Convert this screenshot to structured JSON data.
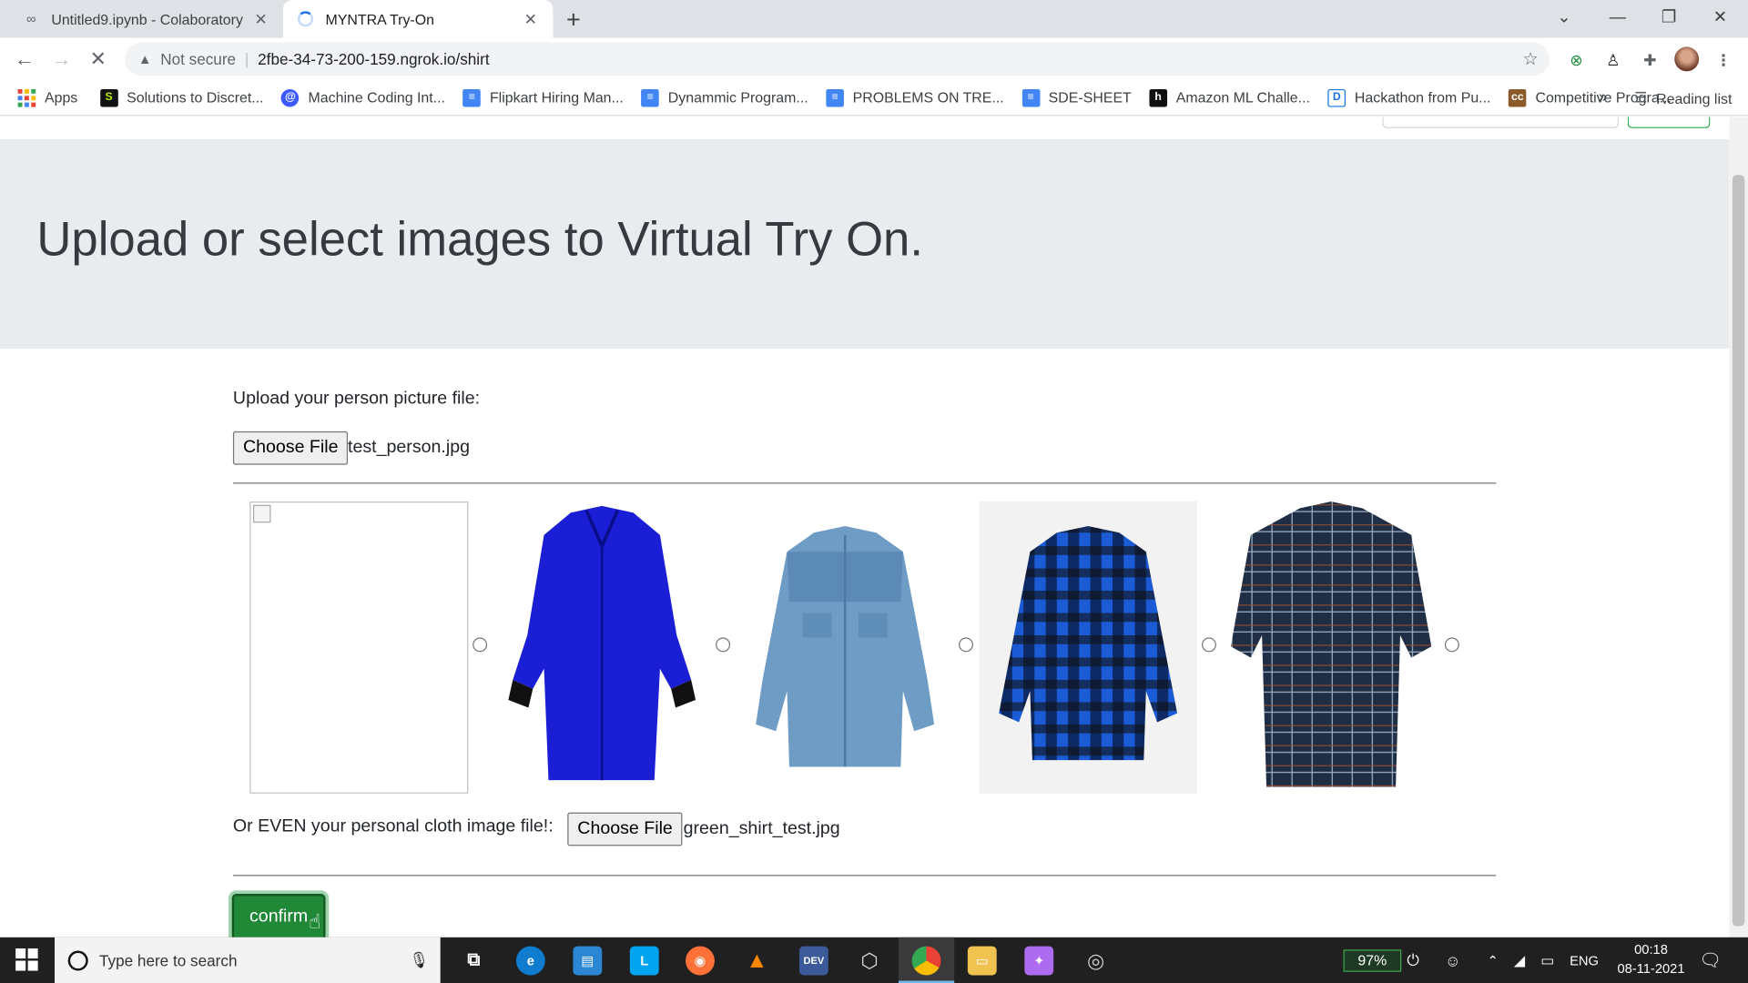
{
  "browser": {
    "tabs": [
      {
        "title": "Untitled9.ipynb - Colaboratory",
        "close": "✕"
      },
      {
        "title": "MYNTRA Try-On",
        "close": "✕"
      }
    ],
    "new_tab": "+",
    "window_controls": {
      "tab_search": "⌄",
      "minimize": "—",
      "restore": "❐",
      "close": "✕"
    },
    "nav": {
      "back": "←",
      "forward": "→",
      "reload": "✕"
    },
    "address": {
      "security_label": "Not secure",
      "separator": "|",
      "url": "2fbe-34-73-200-159.ngrok.io/shirt"
    },
    "bookmarks": [
      "Apps",
      "Solutions to Discret...",
      "Machine Coding Int...",
      "Flipkart Hiring Man...",
      "Dynammic Program...",
      "PROBLEMS ON TRE...",
      "SDE-SHEET",
      "Amazon ML Challe...",
      "Hackathon from Pu...",
      "Competitive Progra..."
    ],
    "bookmarks_more": "»",
    "reading_list": "Reading list"
  },
  "page": {
    "heading": "Upload or select images to Virtual Try On.",
    "person_label": "Upload your person picture file:",
    "choose_file_label": "Choose File",
    "person_file": "test_person.jpg",
    "cloth_label": "Or EVEN your personal cloth image file!:",
    "cloth_file": "green_shirt_test.jpg",
    "confirm_label": "confirm",
    "shirts": [
      {
        "name": "broken-image"
      },
      {
        "name": "blue-shirt",
        "color": "#1a1fd6"
      },
      {
        "name": "denim-shirt",
        "color": "#6f9cc4"
      },
      {
        "name": "blue-plaid-shirt",
        "color": "#1c5bd6"
      },
      {
        "name": "navy-check-shirt",
        "color": "#1f2e45"
      }
    ]
  },
  "taskbar": {
    "search_placeholder": "Type here to search",
    "battery": "97%",
    "language": "ENG",
    "time": "00:18",
    "date": "08-11-2021"
  }
}
